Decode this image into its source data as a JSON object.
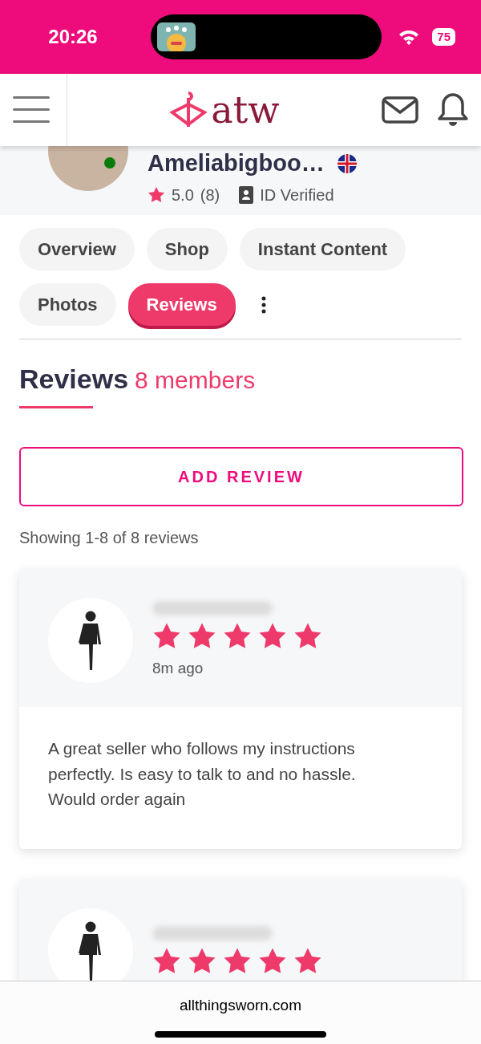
{
  "status_bar": {
    "time": "20:26",
    "battery": "75"
  },
  "header": {
    "logo_text": "atw"
  },
  "profile": {
    "name": "Ameliabigboo…",
    "rating": "5.0",
    "rating_count": "(8)",
    "verification": "ID Verified",
    "online": true
  },
  "tabs": [
    {
      "label": "Overview",
      "selected": false
    },
    {
      "label": "Shop",
      "selected": false
    },
    {
      "label": "Instant Content",
      "selected": false
    },
    {
      "label": "Photos",
      "selected": false
    },
    {
      "label": "Reviews",
      "selected": true
    }
  ],
  "section": {
    "title": "Reviews",
    "count": "8 members"
  },
  "add_button": "ADD REVIEW",
  "summary": "Showing 1-8 of 8 reviews",
  "reviews": [
    {
      "stars": 5,
      "time": "8m ago",
      "text": "A great seller who follows my instructions perfectly. Is easy to talk to and no hassle. Would order again"
    },
    {
      "stars": 5
    }
  ],
  "address_bar": {
    "url": "allthingsworn.com"
  }
}
